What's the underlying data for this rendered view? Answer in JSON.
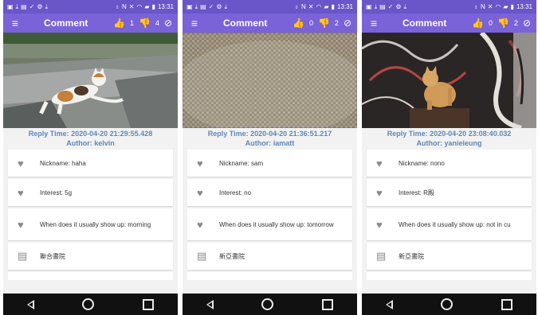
{
  "screens": [
    {
      "status_time": "13:31",
      "title": "Comment",
      "likes": "1",
      "dislikes": "4",
      "reply_time": "Reply Time: 2020-04-20 21:29:55.428",
      "author": "Author: kelvin",
      "nickname": "Nickname: haha",
      "interest": "Interest: 5g",
      "when": "When does it usually show up: morning",
      "place": "聯合書院",
      "photo": "cat-on-rocks"
    },
    {
      "status_time": "13:31",
      "title": "Comment",
      "likes": "0",
      "dislikes": "2",
      "reply_time": "Reply Time: 2020-04-20 21:36:51.217",
      "author": "Author: iamatt",
      "nickname": "Nickname: sam",
      "interest": "Interest: no",
      "when": "When does it usually show up: tomorrow",
      "place": "新亞書院",
      "photo": "burlap-texture"
    },
    {
      "status_time": "13:31",
      "title": "Comment",
      "likes": "0",
      "dislikes": "2",
      "reply_time": "Reply Time: 2020-04-20 23:08:40.032",
      "author": "Author: yanieleung",
      "nickname": "Nickname: nono",
      "interest": "Interest: R殿",
      "when": "When does it usually show up: not in cu",
      "place": "新亞書院",
      "photo": "cat-graffiti"
    }
  ],
  "colors": {
    "statusbar": "#6a55c9",
    "appbar": "#7a62d8",
    "reply_text": "#5f86b6",
    "navbar": "#111111"
  },
  "icons": [
    "menu-icon",
    "thumb-up-icon",
    "thumb-down-icon",
    "block-icon",
    "heart-icon",
    "building-icon"
  ]
}
